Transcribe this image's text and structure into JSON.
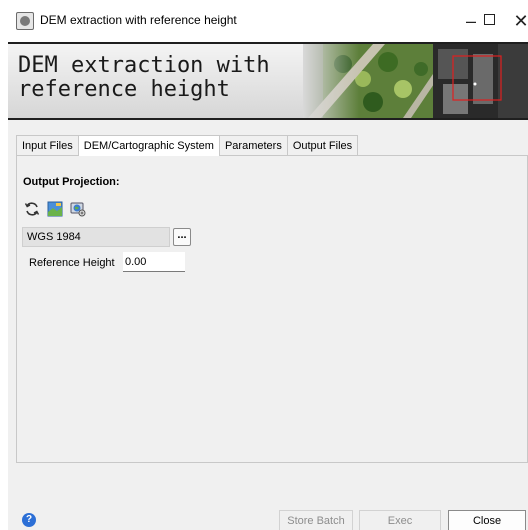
{
  "window": {
    "title": "DEM extraction with reference height",
    "controls": {
      "minimize": "–",
      "close": "✕"
    }
  },
  "banner": {
    "title": "DEM extraction with\nreference height",
    "image_icon": "aerial-imagery"
  },
  "tabs": [
    {
      "label": "Input Files",
      "active": false
    },
    {
      "label": "DEM/Cartographic System",
      "active": true
    },
    {
      "label": "Parameters",
      "active": false
    },
    {
      "label": "Output Files",
      "active": false
    }
  ],
  "projection": {
    "section_label": "Output Projection:",
    "icons": [
      "refresh-icon",
      "map-icon",
      "globe-icon"
    ],
    "value": "WGS 1984",
    "browse_label": "..."
  },
  "reference_height": {
    "label": "Reference Height",
    "value": "0.00"
  },
  "footer": {
    "help_label": "?",
    "store_batch": "Store Batch",
    "exec": "Exec",
    "close": "Close"
  },
  "colors": {
    "help_blue": "#2c6fd6",
    "disabled_text": "#8d8d8d"
  }
}
